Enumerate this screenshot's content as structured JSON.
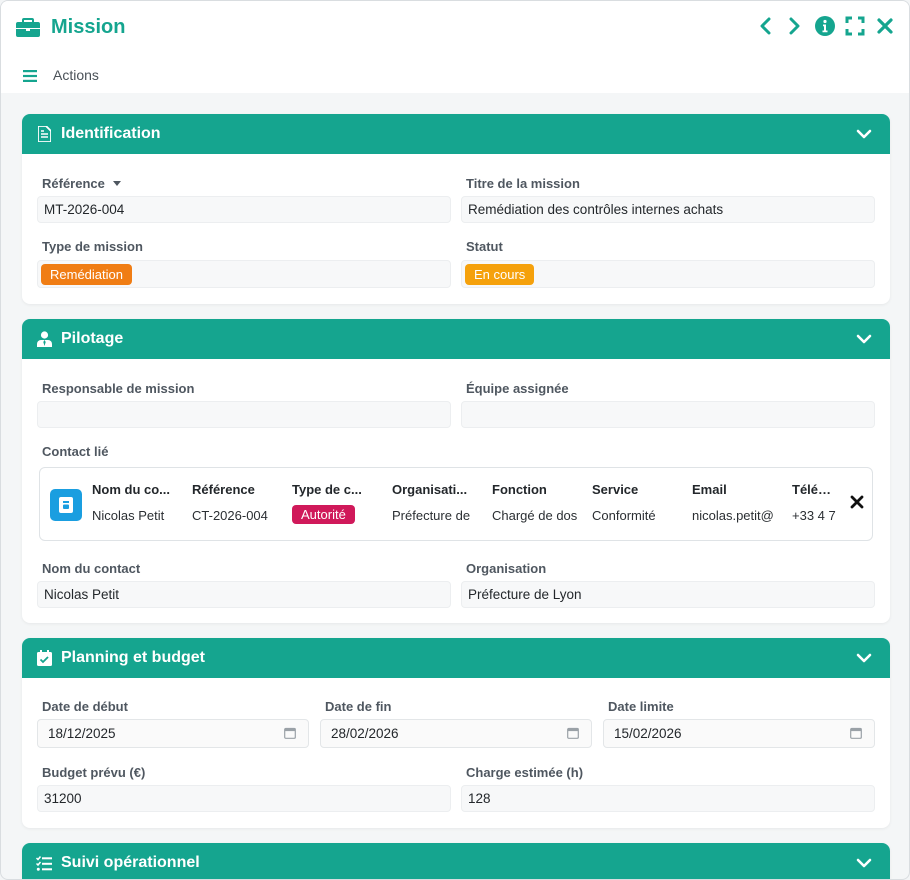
{
  "window": {
    "title": "Mission",
    "actions_label": "Actions"
  },
  "colors": {
    "accent": "#15a58f",
    "remediation_tag": "#f07d14",
    "status_tag": "#f5a10c",
    "authority_tag": "#d0195a",
    "contact_icon": "#1a9ee0"
  },
  "sections": {
    "identification": {
      "title": "Identification",
      "reference_label": "Référence",
      "reference_value": "MT-2026-004",
      "mission_title_label": "Titre de la mission",
      "mission_title_value": "Remédiation des contrôles internes achats",
      "mission_type_label": "Type de mission",
      "mission_type_value": "Remédiation",
      "status_label": "Statut",
      "status_value": "En cours"
    },
    "pilotage": {
      "title": "Pilotage",
      "manager_label": "Responsable de mission",
      "manager_value": "",
      "team_label": "Équipe assignée",
      "team_value": "",
      "linked_contact_label": "Contact lié",
      "contact_columns": [
        {
          "header": "Nom du co...",
          "value": "Nicolas Petit"
        },
        {
          "header": "Référence",
          "value": "CT-2026-004"
        },
        {
          "header": "Type de c...",
          "value": "Autorité"
        },
        {
          "header": "Organisati...",
          "value": "Préfecture de"
        },
        {
          "header": "Fonction",
          "value": "Chargé de dos"
        },
        {
          "header": "Service",
          "value": "Conformité"
        },
        {
          "header": "Email",
          "value": "nicolas.petit@"
        },
        {
          "header": "Télépho",
          "value": "+33 4 7"
        }
      ],
      "contact_name_label": "Nom du contact",
      "contact_name_value": "Nicolas Petit",
      "organisation_label": "Organisation",
      "organisation_value": "Préfecture de Lyon"
    },
    "planning": {
      "title": "Planning et budget",
      "start_label": "Date de début",
      "start_value": "18/12/2025",
      "end_label": "Date de fin",
      "end_value": "28/02/2026",
      "deadline_label": "Date limite",
      "deadline_value": "15/02/2026",
      "budget_label": "Budget prévu (€)",
      "budget_value": "31200",
      "workload_label": "Charge estimée (h)",
      "workload_value": "128"
    },
    "suivi": {
      "title": "Suivi opérationnel"
    }
  }
}
